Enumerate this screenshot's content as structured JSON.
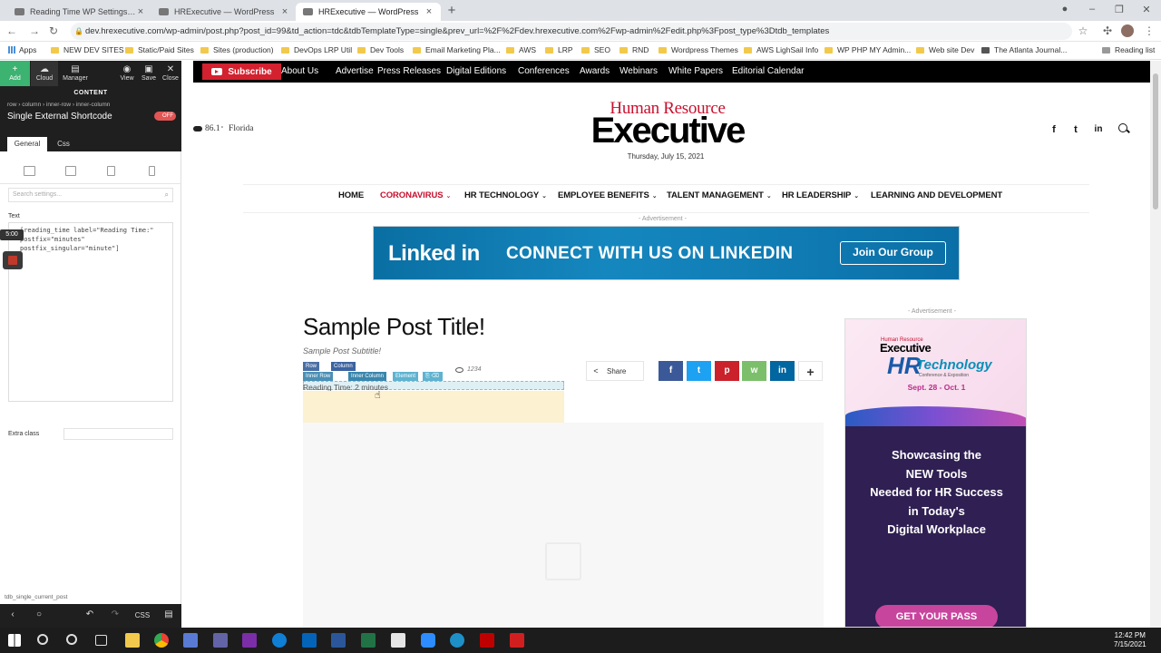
{
  "browser": {
    "tabs": [
      {
        "label": "Reading Time WP Settings › HRE",
        "active": false
      },
      {
        "label": "HRExecutive — WordPress",
        "active": false
      },
      {
        "label": "HRExecutive — WordPress",
        "active": true
      }
    ],
    "url": "dev.hrexecutive.com/wp-admin/post.php?post_id=99&td_action=tdc&tdbTemplateType=single&prev_url=%2F%2Fdev.hrexecutive.com%2Fwp-admin%2Fedit.php%3Fpost_type%3Dtdb_templates",
    "bookmarks": [
      "Apps",
      "NEW DEV SITES",
      "Static/Paid Sites",
      "Sites (production)",
      "DevOps LRP Util",
      "Dev Tools",
      "Email Marketing Pla...",
      "AWS",
      "LRP",
      "SEO",
      "RND",
      "Wordpress Themes",
      "AWS LighSail Info",
      "WP PHP MY Admin...",
      "Web site Dev",
      "The Atlanta Journal...",
      "Reading list"
    ]
  },
  "panel": {
    "tools": [
      "Add",
      "Cloud",
      "Manager",
      "View",
      "Save",
      "Close"
    ],
    "section": "CONTENT",
    "breadcrumb": "row › column › inner-row › inner-column",
    "element_name": "Single External Shortcode",
    "toggle": "OFF",
    "tabs": [
      "General",
      "Css"
    ],
    "search_placeholder": "Search settings...",
    "text_label": "Text",
    "text_value": "[reading_time label=\"Reading Time:\" postfix=\"minutes\" postfix_singular=\"minute\"]",
    "time_badge": "5:00",
    "extra_class_label": "Extra class",
    "status_footer": "tdb_single_current_post",
    "bottom_css": "CSS"
  },
  "site": {
    "subscribe": "Subscribe",
    "top_links": [
      "About Us",
      "Advertise",
      "Press Releases",
      "Digital Editions",
      "Conferences",
      "Awards",
      "Webinars",
      "White Papers",
      "Editorial Calendar"
    ],
    "weather_temp": "86.1",
    "weather_unit": "°",
    "weather_location": "Florida",
    "logo_top": "Human Resource",
    "logo_bottom": "Executive",
    "date": "Thursday, July 15, 2021",
    "social": [
      "f",
      "t",
      "in"
    ],
    "menu": [
      {
        "label": "HOME",
        "dropdown": false
      },
      {
        "label": "CORONAVIRUS",
        "dropdown": true
      },
      {
        "label": "HR TECHNOLOGY",
        "dropdown": true
      },
      {
        "label": "EMPLOYEE BENEFITS",
        "dropdown": true
      },
      {
        "label": "TALENT MANAGEMENT",
        "dropdown": true
      },
      {
        "label": "HR LEADERSHIP",
        "dropdown": true
      },
      {
        "label": "LEARNING AND DEVELOPMENT",
        "dropdown": false
      }
    ],
    "ad_label": "- Advertisement -",
    "banner": {
      "logo": "Linked in",
      "text": "CONNECT WITH US ON LINKEDIN",
      "button": "Join Our Group"
    },
    "post_title": "Sample Post Title!",
    "post_subtitle": "Sample Post Subtitle!",
    "builder_tags": [
      "Row",
      "Column",
      "Inner Row",
      "Inner Column",
      "Element"
    ],
    "views": "1234",
    "reading_time": "Reading Time: 2 minutes",
    "share_label": "Share",
    "share_buttons": [
      {
        "name": "facebook",
        "glyph": "f",
        "color": "#3b5998"
      },
      {
        "name": "twitter",
        "glyph": "t",
        "color": "#1da1f2"
      },
      {
        "name": "pinterest",
        "glyph": "p",
        "color": "#ca212a"
      },
      {
        "name": "whatsapp",
        "glyph": "w",
        "color": "#7bbf6a"
      },
      {
        "name": "linkedin",
        "glyph": "in",
        "color": "#0266a0"
      },
      {
        "name": "more",
        "glyph": "+",
        "color": "#ffffff"
      }
    ],
    "sidebar_ad": {
      "exec_small": "Human Resource",
      "exec": "Executive",
      "hr": "HR",
      "tech": "Technology",
      "tag": "Conference & Exposition",
      "dates": "Sept. 28 - Oct. 1",
      "message": [
        "Showcasing the",
        "NEW Tools",
        "Needed for HR Success",
        "in Today's",
        "Digital Workplace"
      ],
      "button": "GET YOUR PASS"
    }
  },
  "taskbar": {
    "time": "12:42 PM",
    "date": "7/15/2021"
  }
}
